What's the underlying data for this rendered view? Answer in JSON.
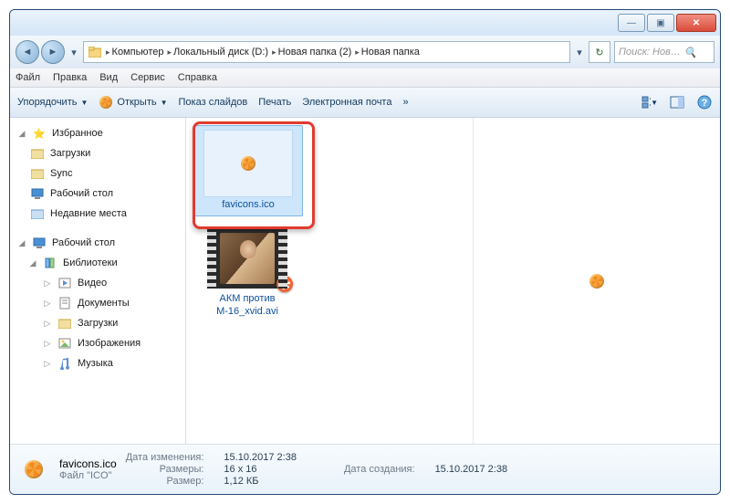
{
  "window_controls": {
    "min": "—",
    "max": "▣",
    "close": "✕"
  },
  "nav": {
    "back": "◄",
    "forward": "►",
    "dropdown": "▾",
    "refresh": "↻"
  },
  "breadcrumbs": [
    "Компьютер",
    "Локальный диск (D:)",
    "Новая папка (2)",
    "Новая папка"
  ],
  "search": {
    "placeholder": "Поиск: Нов…",
    "icon": "🔍"
  },
  "menubar": [
    "Файл",
    "Правка",
    "Вид",
    "Сервис",
    "Справка"
  ],
  "toolbar": {
    "organize": "Упорядочить",
    "open": "Открыть",
    "slideshow": "Показ слайдов",
    "print": "Печать",
    "email": "Электронная почта",
    "overflow": "»"
  },
  "sidebar": {
    "favorites": {
      "label": "Избранное",
      "items": [
        "Загрузки",
        "Sync",
        "Рабочий стол",
        "Недавние места"
      ]
    },
    "desktop": {
      "label": "Рабочий стол"
    },
    "libraries": {
      "label": "Библиотеки",
      "items": [
        "Видео",
        "Документы",
        "Загрузки",
        "Изображения",
        "Музыка"
      ]
    }
  },
  "files": [
    {
      "name": "favicons.ico",
      "selected": true
    },
    {
      "name": "АКМ против М-16_xvid.avi",
      "selected": false
    }
  ],
  "details": {
    "name": "favicons.ico",
    "type": "Файл \"ICO\"",
    "mod_label": "Дата изменения:",
    "mod_val": "15.10.2017 2:38",
    "dim_label": "Размеры:",
    "dim_val": "16 x 16",
    "size_label": "Размер:",
    "size_val": "1,12 КБ",
    "create_label": "Дата создания:",
    "create_val": "15.10.2017 2:38"
  }
}
